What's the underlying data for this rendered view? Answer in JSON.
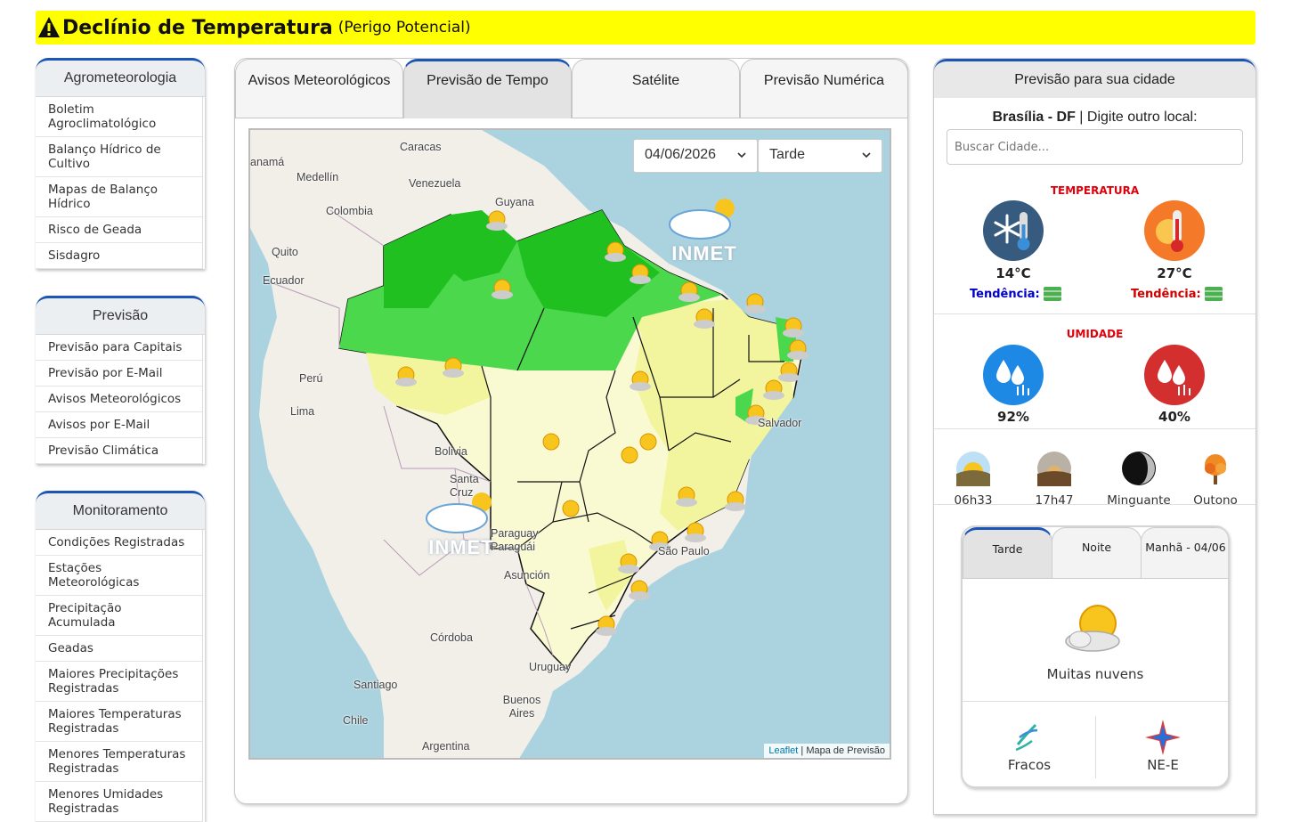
{
  "alert": {
    "title": "Declínio de Temperatura",
    "subtitle": "(Perigo Potencial)"
  },
  "menus": {
    "agro": {
      "title": "Agrometeorologia",
      "items": [
        "Boletim Agroclimatológico",
        "Balanço Hídrico de Cultivo",
        "Mapas de Balanço Hídrico",
        "Risco de Geada",
        "Sisdagro"
      ]
    },
    "previsao": {
      "title": "Previsão",
      "items": [
        "Previsão para Capitais",
        "Previsão por E-Mail",
        "Avisos Meteorológicos",
        "Avisos por E-Mail",
        "Previsão Climática"
      ]
    },
    "monitoramento": {
      "title": "Monitoramento",
      "items": [
        "Condições Registradas",
        "Estações Meteorológicas",
        "Precipitação Acumulada",
        "Geadas",
        "Maiores Precipitações Registradas",
        "Maiores Temperaturas Registradas",
        "Menores Temperaturas Registradas",
        "Menores Umidades Registradas"
      ]
    }
  },
  "tabs": [
    "Avisos Meteorológicos",
    "Previsão de Tempo",
    "Satélite",
    "Previsão Numérica"
  ],
  "map": {
    "date": "04/06/2026",
    "period": "Tarde",
    "logo_text": "INMET",
    "attribution_link": "Leaflet",
    "attribution_text": "| Mapa de Previsão",
    "places": [
      "Caracas",
      "Medellín",
      "Venezuela",
      "Colombia",
      "Guyana",
      "Quito",
      "Ecuador",
      "Perú",
      "Lima",
      "Bolivia",
      "Santa Cruz",
      "Paraguay Paraguái",
      "Asunción",
      "Córdoba",
      "Uruguay",
      "Santiago",
      "Chile",
      "Buenos Aires",
      "Argentina",
      "Salvador",
      "São Paulo",
      "anamá"
    ]
  },
  "right": {
    "header": "Previsão para sua cidade",
    "city": "Brasília - DF",
    "city_suffix": "| Digite outro local:",
    "search_placeholder": "Buscar Cidade...",
    "temperature_title": "TEMPERATURA",
    "temp_min": "14°C",
    "temp_max": "27°C",
    "trend_label": "Tendência:",
    "humidity_title": "UMIDADE",
    "hum_max": "92%",
    "hum_min": "40%",
    "sunrise": "06h33",
    "sunset": "17h47",
    "moon": "Minguante",
    "season": "Outono",
    "forecast_tabs": [
      "Tarde",
      "Noite",
      "Manhã - 04/06"
    ],
    "forecast_desc": "Muitas nuvens",
    "wind_intensity": "Fracos",
    "wind_direction": "NE-E"
  },
  "colors": {
    "accent": "#1b55b5",
    "alert_bg": "#ffff00",
    "section_red": "#e0000b",
    "trend_min": "#0000cc",
    "trend_max": "#d00000"
  }
}
